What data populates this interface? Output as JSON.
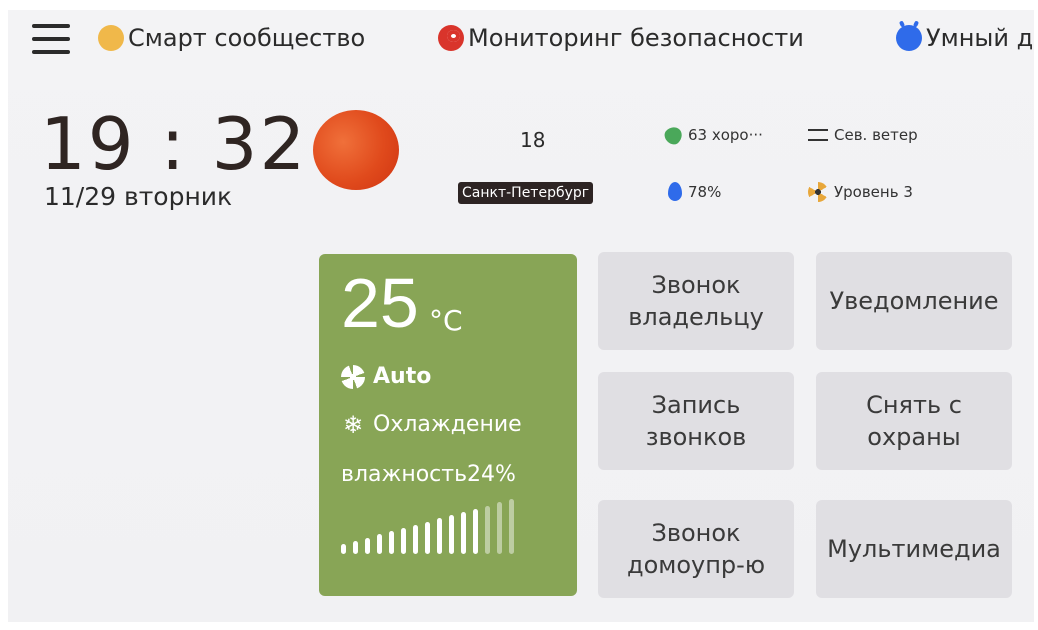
{
  "topbar": {
    "nav": [
      {
        "label": "Смарт сообщество",
        "icon": "community-icon"
      },
      {
        "label": "Мониторинг безопасности",
        "icon": "eye-icon"
      },
      {
        "label": "Умный д",
        "icon": "robot-icon"
      }
    ]
  },
  "clock": {
    "time": "19 : 32",
    "date": "11/29  вторник"
  },
  "weather": {
    "temperature": "18",
    "city": "Санкт-Петербург",
    "air_quality": "63 хоро···",
    "humidity": "78%",
    "wind": "Сев. ветер",
    "level": "Уровень 3"
  },
  "climate": {
    "temperature": "25",
    "unit": "°C",
    "fan_mode": "Auto",
    "mode": "Охлаждение",
    "humidity": "влажность24%",
    "level_filled": 12,
    "level_total": 15,
    "accent_color": "#88a556"
  },
  "tiles": [
    {
      "label": "Звонок\nвладельцу"
    },
    {
      "label": "Уведомление"
    },
    {
      "label": "Запись\nзвонков"
    },
    {
      "label": "Снять с\nохраны"
    },
    {
      "label": "Звонок\nдомоупр-ю"
    },
    {
      "label": "Мультимедиа"
    }
  ]
}
